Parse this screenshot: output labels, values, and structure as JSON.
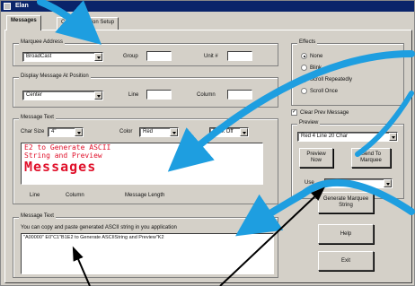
{
  "window": {
    "title": "Elan"
  },
  "tabs": [
    {
      "label": "Messages"
    },
    {
      "label": "Communication Setup"
    }
  ],
  "marquee_address": {
    "title": "Marquee Address",
    "type_value": "BroadCast",
    "group_label": "Group",
    "unit_label": "Unit #"
  },
  "display_position": {
    "title": "Display Message At Position",
    "position_value": "Center",
    "line_label": "Line",
    "column_label": "Column"
  },
  "effects": {
    "title": "Effects",
    "options": [
      "None",
      "Blink",
      "Scroll Repeatedly",
      "Scroll Once"
    ],
    "selected": "None"
  },
  "clear_prev": {
    "label": "Clear Prev Message",
    "checked": true
  },
  "preview": {
    "title": "Preview",
    "sign_value": "Red 4 Line 20 Char",
    "preview_now_label": "Preview Now",
    "send_label": "Send To Marquee",
    "use_label": "Use",
    "use_value": "Com1"
  },
  "message_text": {
    "title": "Message Text",
    "char_size_label": "Char Size",
    "char_size_value": "4\"",
    "color_label": "Color",
    "color_value": "Red",
    "blink_value": "Blink Off",
    "preview_lines": [
      "E2 to Generate ASCII",
      "String and Preview",
      "Messages"
    ],
    "line_label": "Line",
    "column_label": "Column",
    "length_label": "Message Length"
  },
  "message_text2": {
    "title": "Message Text",
    "hint": "You can copy and paste generated ASCII string in you application",
    "ascii_string": "\"A00000\" E0\"C1\"B1E2 to Generate ASCIIString and Preview\"K2"
  },
  "buttons": {
    "generate": "Generate Marquee String",
    "help": "Help",
    "exit": "Exit"
  },
  "colors": {
    "arrow_blue": "#1e9ee0",
    "message_red": "#e0102a",
    "window_gray": "#d4d0c8"
  }
}
